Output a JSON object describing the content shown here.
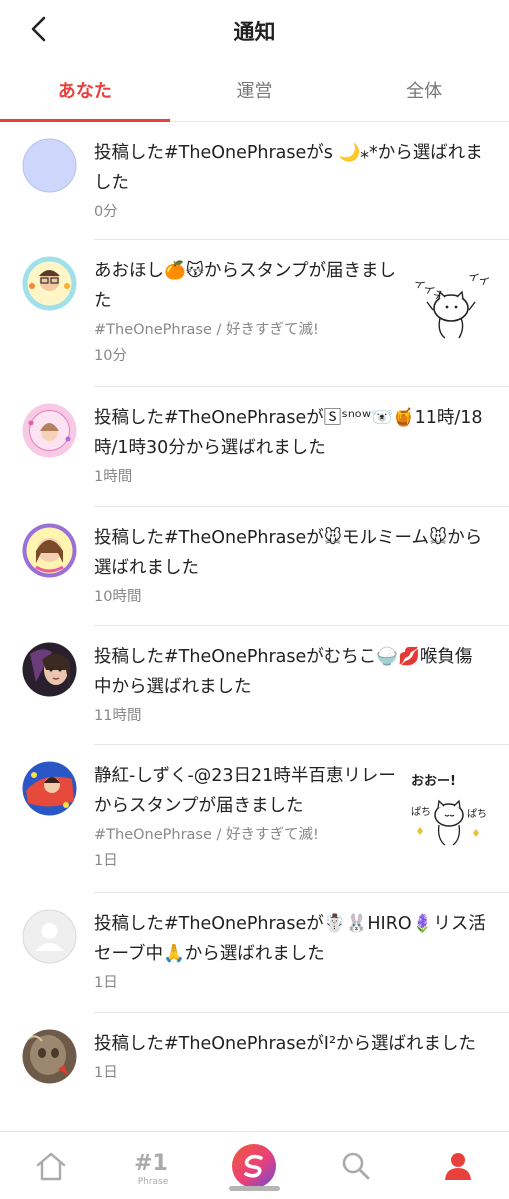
{
  "header": {
    "title": "通知",
    "back_icon": "chevron-left-icon"
  },
  "tabs": [
    {
      "label": "あなた",
      "active": true
    },
    {
      "label": "運営",
      "active": false
    },
    {
      "label": "全体",
      "active": false
    }
  ],
  "notifications": [
    {
      "message": "投稿した#TheOnePhraseがs 🌙⁎*から選ばれました",
      "sub": "",
      "time": "0分"
    },
    {
      "message": "あおほし🍊😽からスタンプが届きました",
      "sub": "#TheOnePhrase / 好きすぎて滅!",
      "time": "10分",
      "stamp_text": "イイネ イイネ"
    },
    {
      "message": "投稿した#TheOnePhraseが🅂ˢⁿᵒʷ🐻‍❄️🍯11時/18時/1時30分から選ばれました",
      "sub": "",
      "time": "1時間"
    },
    {
      "message": "投稿した#TheOnePhraseが🐭モルミーム🐭から選ばれました",
      "sub": "",
      "time": "10時間"
    },
    {
      "message": "投稿した#TheOnePhraseがむちこ🍚💋喉負傷中から選ばれました",
      "sub": "",
      "time": "11時間"
    },
    {
      "message": "静紅-しずく-@23日21時半百恵リレーからスタンプが届きました",
      "sub": "#TheOnePhrase / 好きすぎて滅!",
      "time": "1日",
      "stamp_text": "おおー!",
      "stamp_text2": "ぱち ぱち"
    },
    {
      "message": "投稿した#TheOnePhraseが☃️🐰HIRO🪻リス活セーブ中🙏から選ばれました",
      "sub": "",
      "time": "1日"
    },
    {
      "message": "投稿した#TheOnePhraseがI²から選ばれました",
      "sub": "",
      "time": "1日"
    }
  ],
  "bottom_nav": {
    "items": [
      {
        "name": "home",
        "icon": "home-icon"
      },
      {
        "name": "phrase",
        "icon": "phrase-icon",
        "label": "Phrase",
        "badge": "#1"
      },
      {
        "name": "post",
        "icon": "post-logo-icon"
      },
      {
        "name": "search",
        "icon": "search-icon"
      },
      {
        "name": "profile",
        "icon": "profile-icon",
        "active": true
      }
    ]
  },
  "colors": {
    "accent": "#e8403d",
    "text": "#222222",
    "muted": "#888888"
  }
}
